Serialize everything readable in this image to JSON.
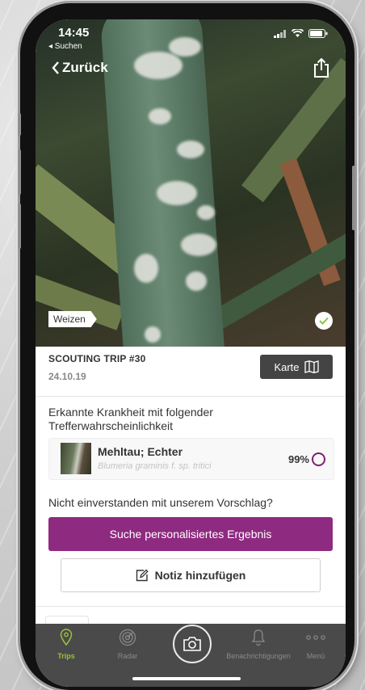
{
  "status": {
    "time": "14:45",
    "back_app": "◂ Suchen"
  },
  "nav": {
    "back_label": "Zurück"
  },
  "photo": {
    "crop_tag": "Weizen"
  },
  "trip": {
    "title": "SCOUTING TRIP #30",
    "date": "24.10.19",
    "map_button": "Karte"
  },
  "detection": {
    "heading": "Erkannte Krankheit mit folgender Trefferwahrscheinlichkeit",
    "result": {
      "name": "Mehltau; Echter",
      "latin": "Blumeria graminis f. sp. tritici",
      "probability": "99%"
    }
  },
  "feedback": {
    "question": "Nicht einverstanden mit unserem Vorschlag?",
    "primary_button": "Suche personalisiertes Ergebnis",
    "note_button": "Notiz hinzufügen"
  },
  "tabs": [
    {
      "label": "Trips",
      "icon": "location-pin-icon",
      "active": true
    },
    {
      "label": "Radar",
      "icon": "radar-icon",
      "active": false
    },
    {
      "label": "",
      "icon": "camera-icon",
      "active": false
    },
    {
      "label": "Benachrichtigungen",
      "icon": "bell-icon",
      "active": false
    },
    {
      "label": "Menü",
      "icon": "more-dots-icon",
      "active": false
    }
  ],
  "colors": {
    "primary": "#8e2a80",
    "active_tab": "#9bc23c",
    "tabbar": "#4a4a4a",
    "map_button": "#444444"
  }
}
